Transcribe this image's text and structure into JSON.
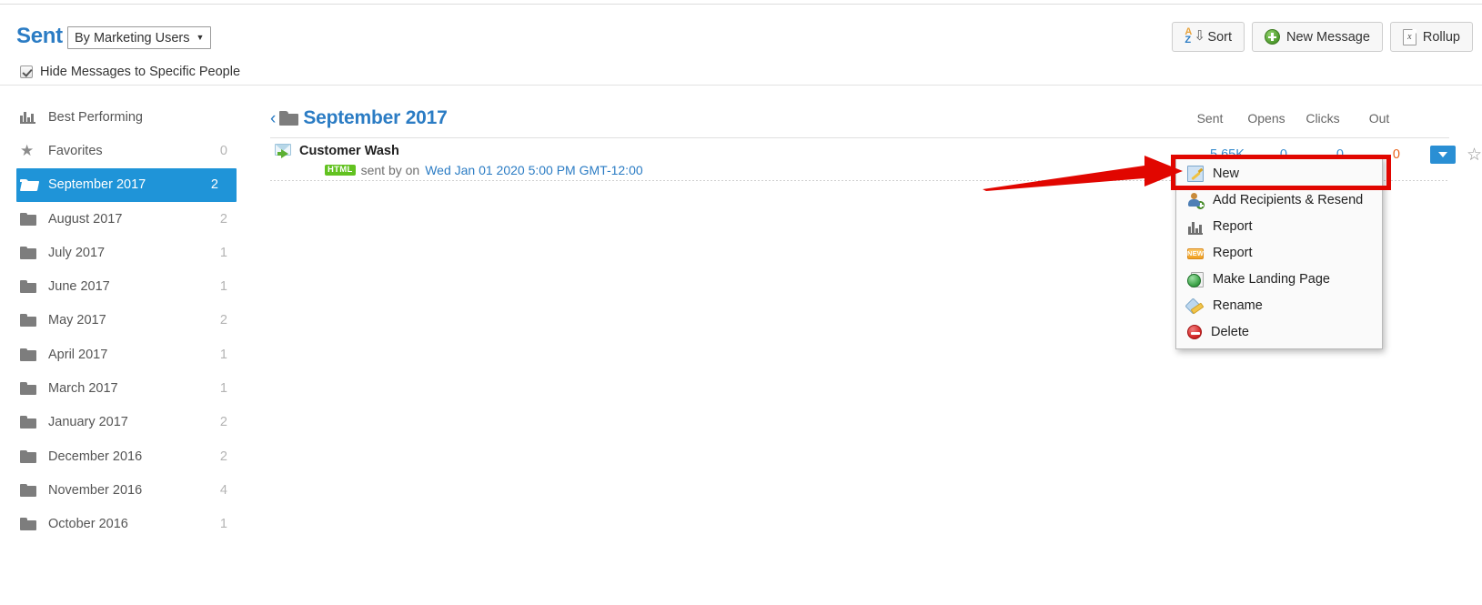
{
  "header": {
    "title": "Sent",
    "scope_label": "By Marketing Users",
    "scope_caret": "▼",
    "hide_messages_label": "Hide Messages to Specific People",
    "buttons": [
      {
        "label": "Sort",
        "icon": "sort-icon"
      },
      {
        "label": "New Message",
        "icon": "plus-circle-icon"
      },
      {
        "label": "Rollup",
        "icon": "excel-document-icon"
      }
    ]
  },
  "sidebar": {
    "items": [
      {
        "label": "Best Performing",
        "count": "",
        "icon": "bar-chart-icon",
        "active": false
      },
      {
        "label": "Favorites",
        "count": "0",
        "icon": "star-icon",
        "active": false
      },
      {
        "label": "September 2017",
        "count": "2",
        "icon": "folder-open-icon",
        "active": true
      },
      {
        "label": "August 2017",
        "count": "2",
        "icon": "folder-icon",
        "active": false
      },
      {
        "label": "July 2017",
        "count": "1",
        "icon": "folder-icon",
        "active": false
      },
      {
        "label": "June 2017",
        "count": "1",
        "icon": "folder-icon",
        "active": false
      },
      {
        "label": "May 2017",
        "count": "2",
        "icon": "folder-icon",
        "active": false
      },
      {
        "label": "April 2017",
        "count": "1",
        "icon": "folder-icon",
        "active": false
      },
      {
        "label": "March 2017",
        "count": "1",
        "icon": "folder-icon",
        "active": false
      },
      {
        "label": "January 2017",
        "count": "2",
        "icon": "folder-icon",
        "active": false
      },
      {
        "label": "December 2016",
        "count": "2",
        "icon": "folder-icon",
        "active": false
      },
      {
        "label": "November 2016",
        "count": "4",
        "icon": "folder-icon",
        "active": false
      },
      {
        "label": "October 2016",
        "count": "1",
        "icon": "folder-icon",
        "active": false
      }
    ]
  },
  "main": {
    "back_chevron": "‹",
    "folder_title": "September 2017",
    "columns": {
      "sent": "Sent",
      "opens": "Opens",
      "clicks": "Clicks",
      "out": "Out"
    },
    "message": {
      "title": "Customer Wash",
      "format_badge": "HTML",
      "sent_by_text": "sent by on",
      "date": "Wed Jan 01 2020 5:00 PM GMT-12:00",
      "stats": {
        "sent": "5.65K",
        "opens": "0",
        "clicks": "0",
        "out": "0"
      },
      "actions_caret": "▼",
      "favorite_star": "☆"
    }
  },
  "context_menu": {
    "items": [
      {
        "label": "New",
        "icon": "new-document-icon",
        "highlighted": true
      },
      {
        "label": "Add Recipients & Resend",
        "icon": "add-recipient-icon",
        "highlighted": false
      },
      {
        "label": "Report",
        "icon": "bar-chart-icon",
        "highlighted": false
      },
      {
        "label": "Report",
        "icon": "new-badge-icon",
        "highlighted": false
      },
      {
        "label": "Make Landing Page",
        "icon": "globe-page-icon",
        "highlighted": false
      },
      {
        "label": "Rename",
        "icon": "rename-tag-icon",
        "highlighted": false
      },
      {
        "label": "Delete",
        "icon": "delete-icon",
        "highlighted": false
      }
    ],
    "new_badge_text": "NEW"
  },
  "annotation": {
    "highlight_color": "#e10600",
    "arrow_color": "#e10600"
  },
  "colors": {
    "accent_blue": "#2b7cc4",
    "active_blue": "#1f94d8",
    "out_orange": "#e8621a",
    "badge_green": "#62c220"
  }
}
